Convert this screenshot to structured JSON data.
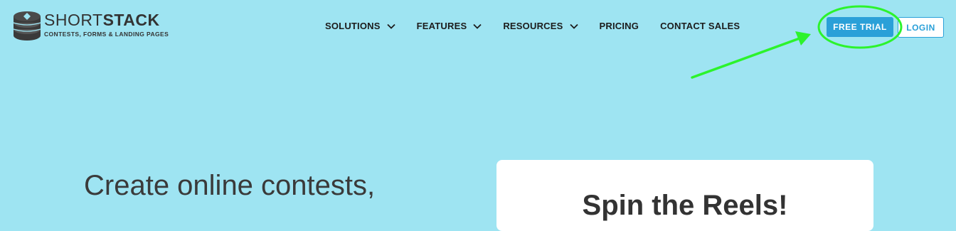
{
  "logo": {
    "word_light": "SHORT",
    "word_bold": "STACK",
    "tagline": "CONTESTS, FORMS & LANDING PAGES",
    "icon": "stack-icon"
  },
  "nav": {
    "items": [
      {
        "label": "SOLUTIONS",
        "has_dropdown": true
      },
      {
        "label": "FEATURES",
        "has_dropdown": true
      },
      {
        "label": "RESOURCES",
        "has_dropdown": true
      },
      {
        "label": "PRICING",
        "has_dropdown": false
      },
      {
        "label": "CONTACT SALES",
        "has_dropdown": false
      }
    ]
  },
  "buttons": {
    "free_trial": "FREE TRIAL",
    "login": "LOGIN"
  },
  "hero": {
    "headline_line1": "Create online contests,",
    "card_title": "Spin the Reels!"
  },
  "colors": {
    "background": "#9ee4f2",
    "accent": "#2aa0d8",
    "annotation": "#2cf32c"
  }
}
